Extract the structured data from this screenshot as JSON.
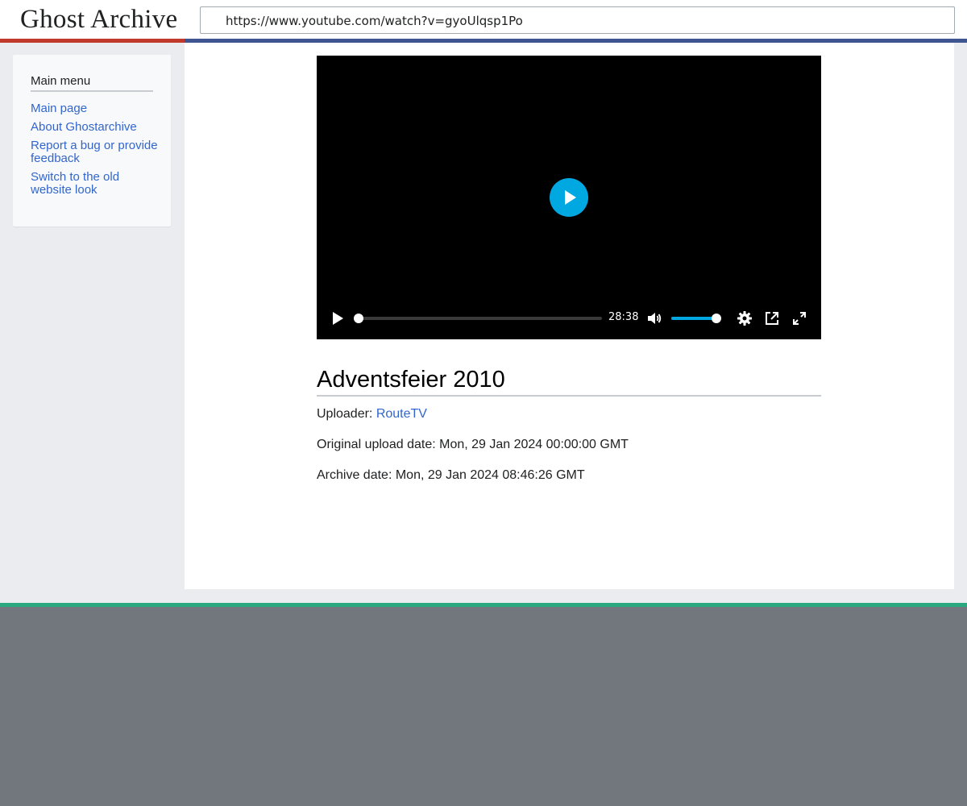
{
  "header": {
    "logo_text": "Ghost Archive",
    "url": "https://www.youtube.com/watch?v=gyoUlqsp1Po"
  },
  "sidebar": {
    "title": "Main menu",
    "items": [
      {
        "label": "Main page"
      },
      {
        "label": "About Ghostarchive"
      },
      {
        "label": "Report a bug or provide feedback"
      },
      {
        "label": "Switch to the old website look"
      }
    ]
  },
  "player": {
    "duration": "28:38",
    "progress_fraction": 0,
    "volume_fraction": 1,
    "icons": [
      "play-icon",
      "mute-icon",
      "settings-icon",
      "pip-icon",
      "fullscreen-icon"
    ]
  },
  "video": {
    "title": "Adventsfeier 2010",
    "uploader_label": "Uploader:",
    "uploader": "RouteTV",
    "upload_date_label": "Original upload date:",
    "upload_date": "Mon, 29 Jan 2024 00:00:00 GMT",
    "archive_date_label": "Archive date:",
    "archive_date": "Mon, 29 Jan 2024 08:46:26 GMT"
  },
  "colors": {
    "accent_blue": "#00a8e2",
    "link": "#3366cc",
    "header_red": "#c0392b",
    "header_blue": "#3e5591",
    "footer_green": "#2aa87e",
    "footer_gray": "#72777d"
  }
}
